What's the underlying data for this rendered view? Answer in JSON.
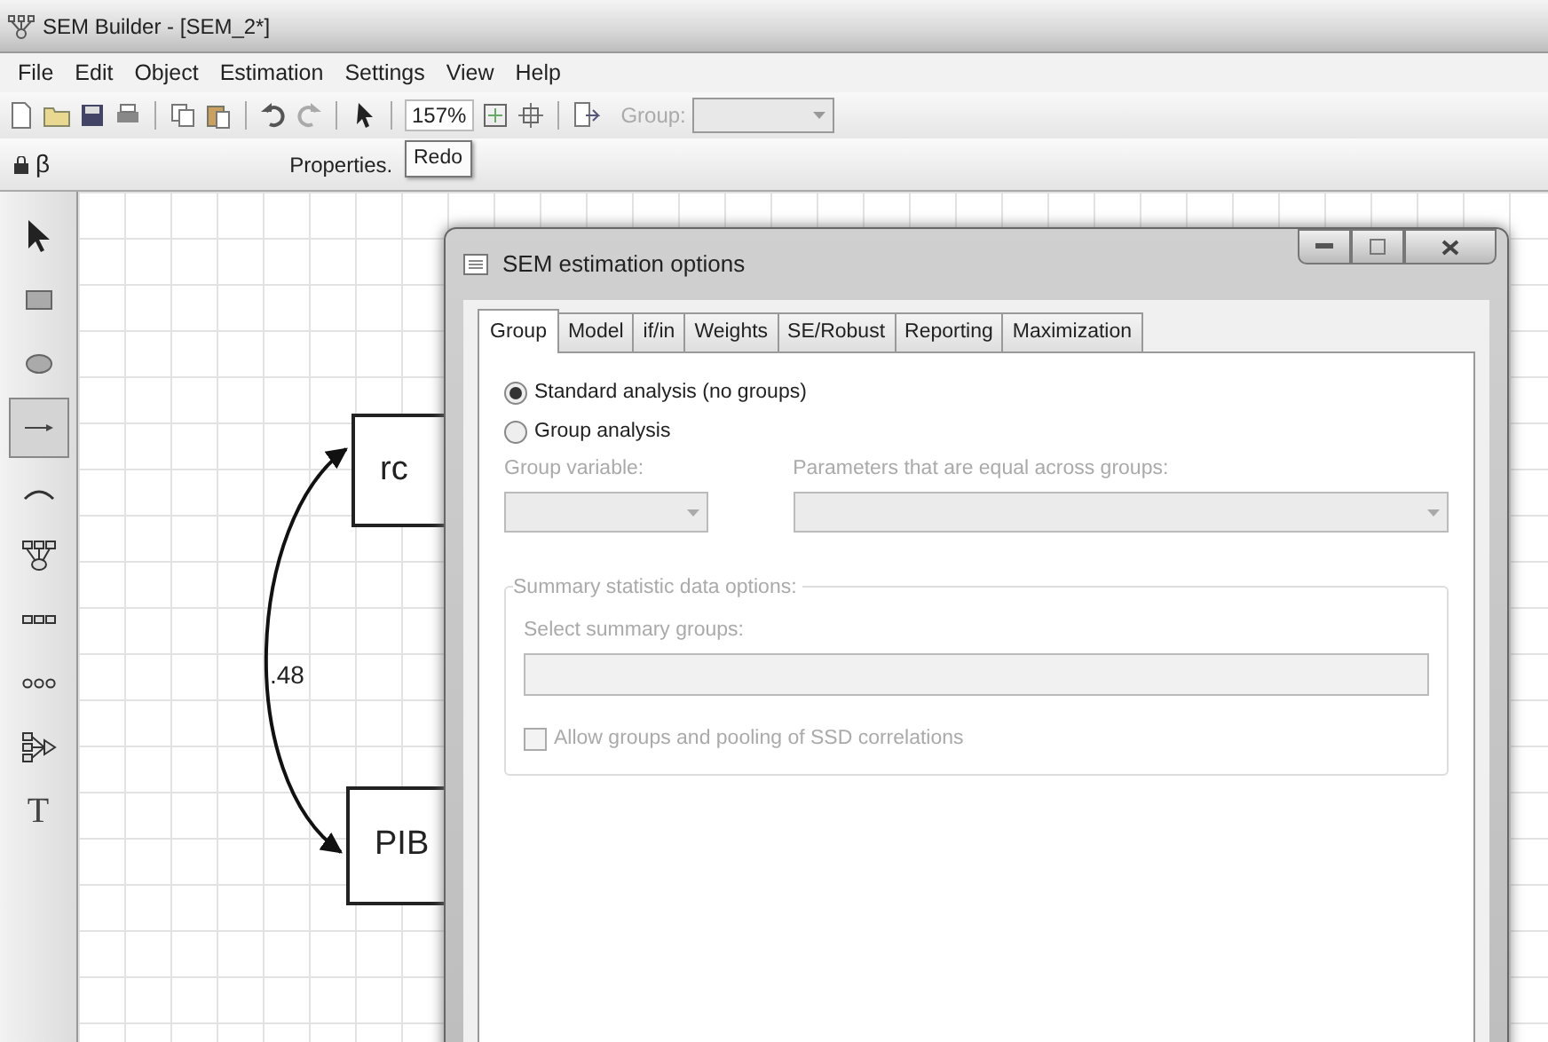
{
  "window": {
    "title": "SEM Builder - [SEM_2*]"
  },
  "menu": [
    "File",
    "Edit",
    "Object",
    "Estimation",
    "Settings",
    "View",
    "Help"
  ],
  "toolbar": {
    "zoom": "157%",
    "group_label": "Group:",
    "group_disabled": true
  },
  "properties_bar": {
    "lock_label": "β",
    "label": "Properties.",
    "tooltip": "Redo"
  },
  "tools": [
    {
      "kind": "select",
      "selected": false
    },
    {
      "kind": "box",
      "selected": false
    },
    {
      "kind": "oval",
      "selected": false
    },
    {
      "kind": "path",
      "selected": true
    },
    {
      "kind": "covariance",
      "selected": false
    },
    {
      "kind": "measurement",
      "selected": false
    },
    {
      "kind": "observed-set",
      "selected": false
    },
    {
      "kind": "latent-set",
      "selected": false
    },
    {
      "kind": "regression",
      "selected": false
    },
    {
      "kind": "text",
      "label": "T",
      "selected": false
    }
  ],
  "canvas": {
    "nodes": [
      {
        "label": "rc"
      },
      {
        "label": "PIB"
      }
    ],
    "covariance_label": ".48"
  },
  "dialog": {
    "title": "SEM estimation options",
    "tabs": [
      {
        "label": "Group",
        "selected": true
      },
      {
        "label": "Model",
        "selected": false
      },
      {
        "label": "if/in",
        "selected": false
      },
      {
        "label": "Weights",
        "selected": false
      },
      {
        "label": "SE/Robust",
        "selected": false
      },
      {
        "label": "Reporting",
        "selected": false
      },
      {
        "label": "Maximization",
        "selected": false
      }
    ],
    "analysis": [
      {
        "label": "Standard analysis (no groups)",
        "selected": true
      },
      {
        "label": "Group analysis",
        "selected": false
      }
    ],
    "group_variable": {
      "label": "Group variable:",
      "disabled": true
    },
    "equal_parameters": {
      "label": "Parameters that are equal across groups:",
      "disabled": true
    },
    "summary": {
      "legend": "Summary statistic data options:",
      "select_label": "Select summary groups:",
      "disabled": true,
      "pooling": {
        "label": "Allow groups and pooling of SSD correlations",
        "checked": false,
        "disabled": true
      }
    }
  }
}
